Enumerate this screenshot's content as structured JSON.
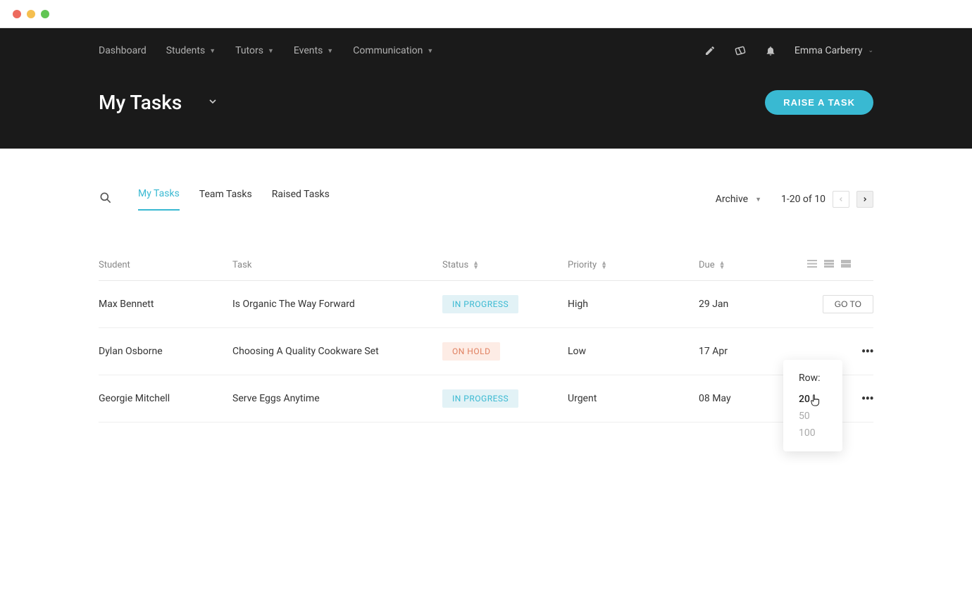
{
  "nav": {
    "items": [
      "Dashboard",
      "Students",
      "Tutors",
      "Events",
      "Communication"
    ],
    "user": "Emma Carberry"
  },
  "page": {
    "title": "My Tasks",
    "raise_button": "RAISE A TASK"
  },
  "tabs": {
    "items": [
      "My Tasks",
      "Team Tasks",
      "Raised Tasks"
    ],
    "archive_label": "Archive",
    "pager_text": "1-20 of 10"
  },
  "table": {
    "headers": {
      "student": "Student",
      "task": "Task",
      "status": "Status",
      "priority": "Priority",
      "due": "Due"
    },
    "rows": [
      {
        "student": "Max Bennett",
        "task": "Is Organic The Way Forward",
        "status": "IN PROGRESS",
        "status_class": "status-inprogress",
        "priority": "High",
        "due": "29 Jan",
        "go_to": "GO TO"
      },
      {
        "student": "Dylan Osborne",
        "task": "Choosing A Quality Cookware Set",
        "status": "ON HOLD",
        "status_class": "status-onhold",
        "priority": "Low",
        "due": "17 Apr"
      },
      {
        "student": "Georgie Mitchell",
        "task": "Serve Eggs Anytime",
        "status": "IN PROGRESS",
        "status_class": "status-inprogress",
        "priority": "Urgent",
        "due": "08 May"
      }
    ]
  },
  "row_popup": {
    "label": "Row:",
    "options": [
      "20",
      "50",
      "100"
    ]
  }
}
